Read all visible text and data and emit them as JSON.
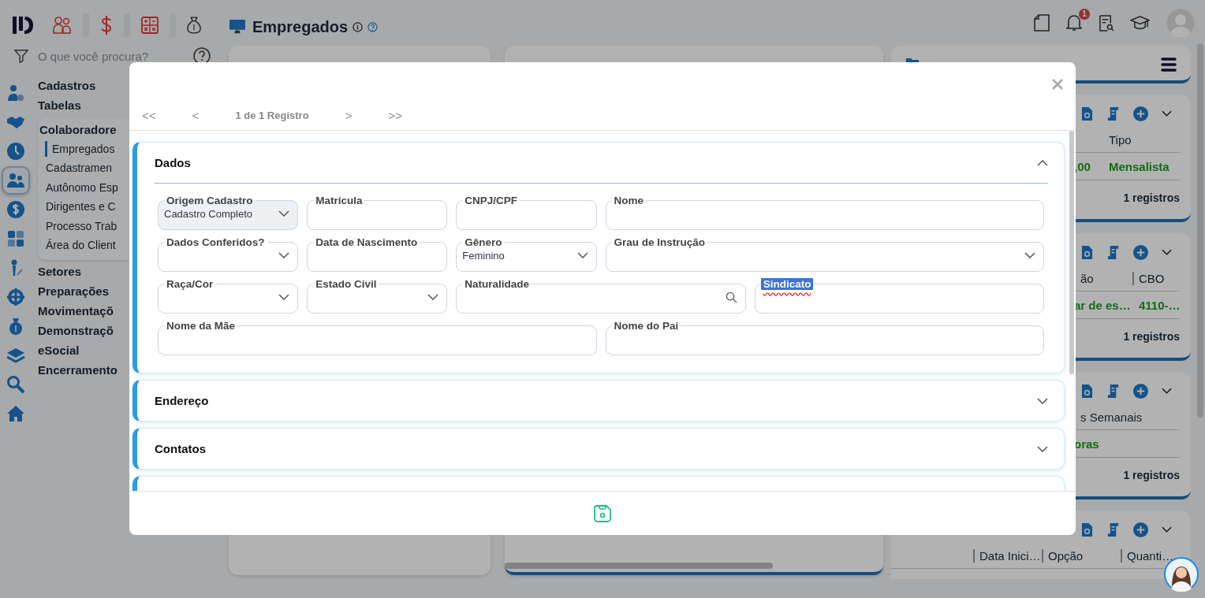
{
  "search": {
    "placeholder": "O que você procura?"
  },
  "icon_rail": [
    {
      "selected": false
    },
    {
      "selected": false
    },
    {
      "selected": false
    },
    {
      "selected": true
    },
    {
      "selected": false
    },
    {
      "selected": false
    },
    {
      "selected": false
    },
    {
      "selected": false
    },
    {
      "selected": false
    },
    {
      "selected": false
    },
    {
      "selected": false
    },
    {
      "selected": false
    }
  ],
  "nav": [
    {
      "label": "Cadastros",
      "expanded": false
    },
    {
      "label": "Tabelas",
      "expanded": false
    },
    {
      "label": "Colaboradore",
      "expanded": true,
      "children": [
        {
          "label": "Empregados",
          "selected": true
        },
        {
          "label": "Cadastramen",
          "selected": false
        },
        {
          "label": "Autônomo Esp",
          "selected": false
        },
        {
          "label": "Dirigentes e C",
          "selected": false
        },
        {
          "label": "Processo Trab",
          "selected": false
        },
        {
          "label": "Área do Client",
          "selected": false
        }
      ]
    },
    {
      "label": "Setores",
      "expanded": false
    },
    {
      "label": "Preparações",
      "expanded": false
    },
    {
      "label": "Movimentaçõ",
      "expanded": false
    },
    {
      "label": "Demonstraçõ",
      "expanded": false
    },
    {
      "label": "eSocial",
      "expanded": false
    },
    {
      "label": "Encerramento",
      "expanded": false
    }
  ],
  "page": {
    "title": "Empregados"
  },
  "notifications": {
    "count": "1"
  },
  "contracts_panel": {
    "cards": [
      {
        "headings": [
          "Tipo"
        ],
        "cells": [
          ",00",
          "Mensalista"
        ],
        "footer": "1 registros"
      },
      {
        "headings": [
          "ão",
          "CBO"
        ],
        "cells": [
          "ar de es…",
          "4110-…"
        ],
        "footer": "1 registros"
      },
      {
        "headings": [
          "s Semanais"
        ],
        "cells": [
          "oras"
        ],
        "footer": "1 registros"
      },
      {
        "headings": [
          "Data Inici…",
          "Opção",
          "Quanti…"
        ]
      }
    ]
  },
  "modal": {
    "nav": {
      "first": "<<",
      "prev": "<",
      "status": "1 de 1 Registro",
      "next": ">",
      "last": ">>"
    },
    "sections": [
      {
        "title": "Dados",
        "expanded": true,
        "fields": [
          {
            "label": "Origem Cadastro",
            "kind": "select",
            "value": "Cadastro Completo",
            "disabled": true,
            "highlighted": false
          },
          {
            "label": "Matrícula",
            "kind": "text",
            "disabled": false,
            "highlighted": false
          },
          {
            "label": "CNPJ/CPF",
            "kind": "text",
            "disabled": false,
            "highlighted": false
          },
          {
            "label": "Nome",
            "kind": "text",
            "disabled": false,
            "highlighted": false
          },
          {
            "label": "Dados Conferidos?",
            "kind": "select",
            "disabled": false,
            "highlighted": false
          },
          {
            "label": "Data de Nascimento",
            "kind": "text",
            "disabled": false,
            "highlighted": false
          },
          {
            "label": "Gênero",
            "kind": "select",
            "value": "Feminino",
            "disabled": false,
            "highlighted": false
          },
          {
            "label": "Grau de Instrução",
            "kind": "select",
            "disabled": false,
            "highlighted": false
          },
          {
            "label": "Raça/Cor",
            "kind": "select",
            "disabled": false,
            "highlighted": false
          },
          {
            "label": "Estado Civil",
            "kind": "select",
            "disabled": false,
            "highlighted": false
          },
          {
            "label": "Naturalidade",
            "kind": "search",
            "disabled": false,
            "highlighted": false
          },
          {
            "label": "Sindicato",
            "kind": "text",
            "disabled": false,
            "highlighted": true
          },
          {
            "label": "Nome da Mãe",
            "kind": "text",
            "disabled": false,
            "highlighted": false
          },
          {
            "label": "Nome do Pai",
            "kind": "text",
            "disabled": false,
            "highlighted": false
          }
        ]
      },
      {
        "title": "Endereço",
        "expanded": false
      },
      {
        "title": "Contatos",
        "expanded": false
      },
      {
        "expanded": false
      }
    ]
  }
}
